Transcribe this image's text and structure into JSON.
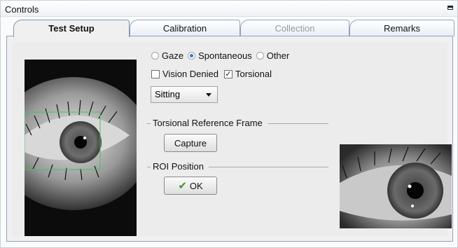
{
  "panel": {
    "title": "Controls"
  },
  "tabs": [
    {
      "label": "Test Setup",
      "state": "active"
    },
    {
      "label": "Calibration",
      "state": "normal"
    },
    {
      "label": "Collection",
      "state": "disabled"
    },
    {
      "label": "Remarks",
      "state": "normal"
    }
  ],
  "mode": {
    "options": [
      "Gaze",
      "Spontaneous",
      "Other"
    ],
    "selected": "Spontaneous"
  },
  "checks": {
    "vision_denied": {
      "label": "Vision Denied",
      "checked": false
    },
    "torsional": {
      "label": "Torsional",
      "checked": true
    }
  },
  "position": {
    "selected": "Sitting"
  },
  "torsional_frame": {
    "title": "Torsional Reference Frame",
    "capture_label": "Capture"
  },
  "roi": {
    "title": "ROI Position",
    "ok_label": "OK"
  },
  "colors": {
    "accent": "#3b78c8",
    "roi_box": "#3cc85a",
    "ok_check": "#3a9a2a"
  }
}
